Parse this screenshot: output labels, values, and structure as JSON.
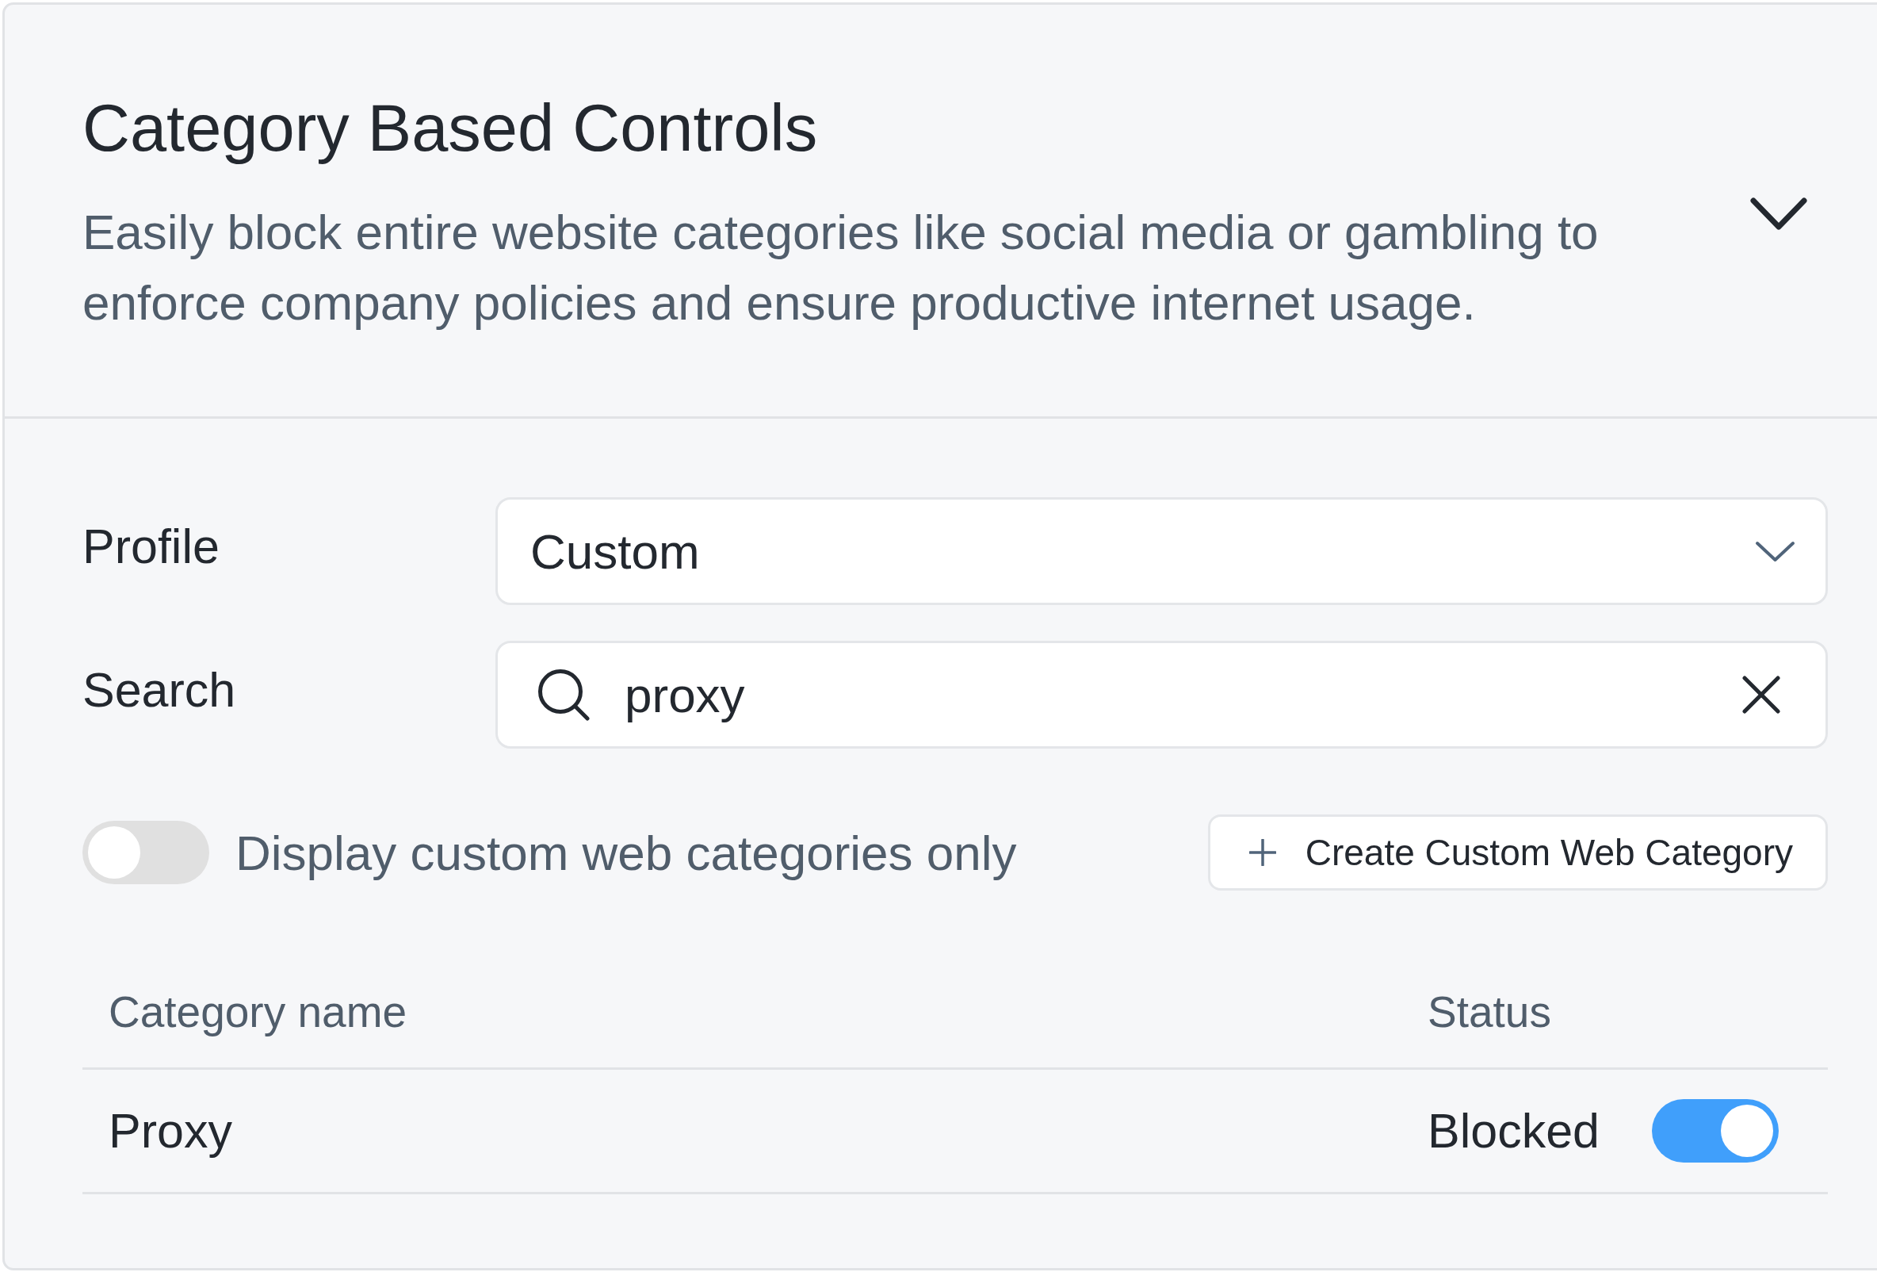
{
  "section": {
    "title": "Category Based Controls",
    "description": "Easily block entire website categories like social media or gambling to enforce company policies and ensure productive internet usage.",
    "expanded": true
  },
  "profile": {
    "label": "Profile",
    "value": "Custom"
  },
  "search": {
    "label": "Search",
    "value": "proxy"
  },
  "custom_only_toggle": {
    "label": "Display custom web categories only",
    "on": false
  },
  "create_button": {
    "label": "Create Custom Web Category"
  },
  "table": {
    "columns": [
      "Category name",
      "Status"
    ],
    "rows": [
      {
        "name": "Proxy",
        "status": "Blocked",
        "on": true
      }
    ]
  }
}
